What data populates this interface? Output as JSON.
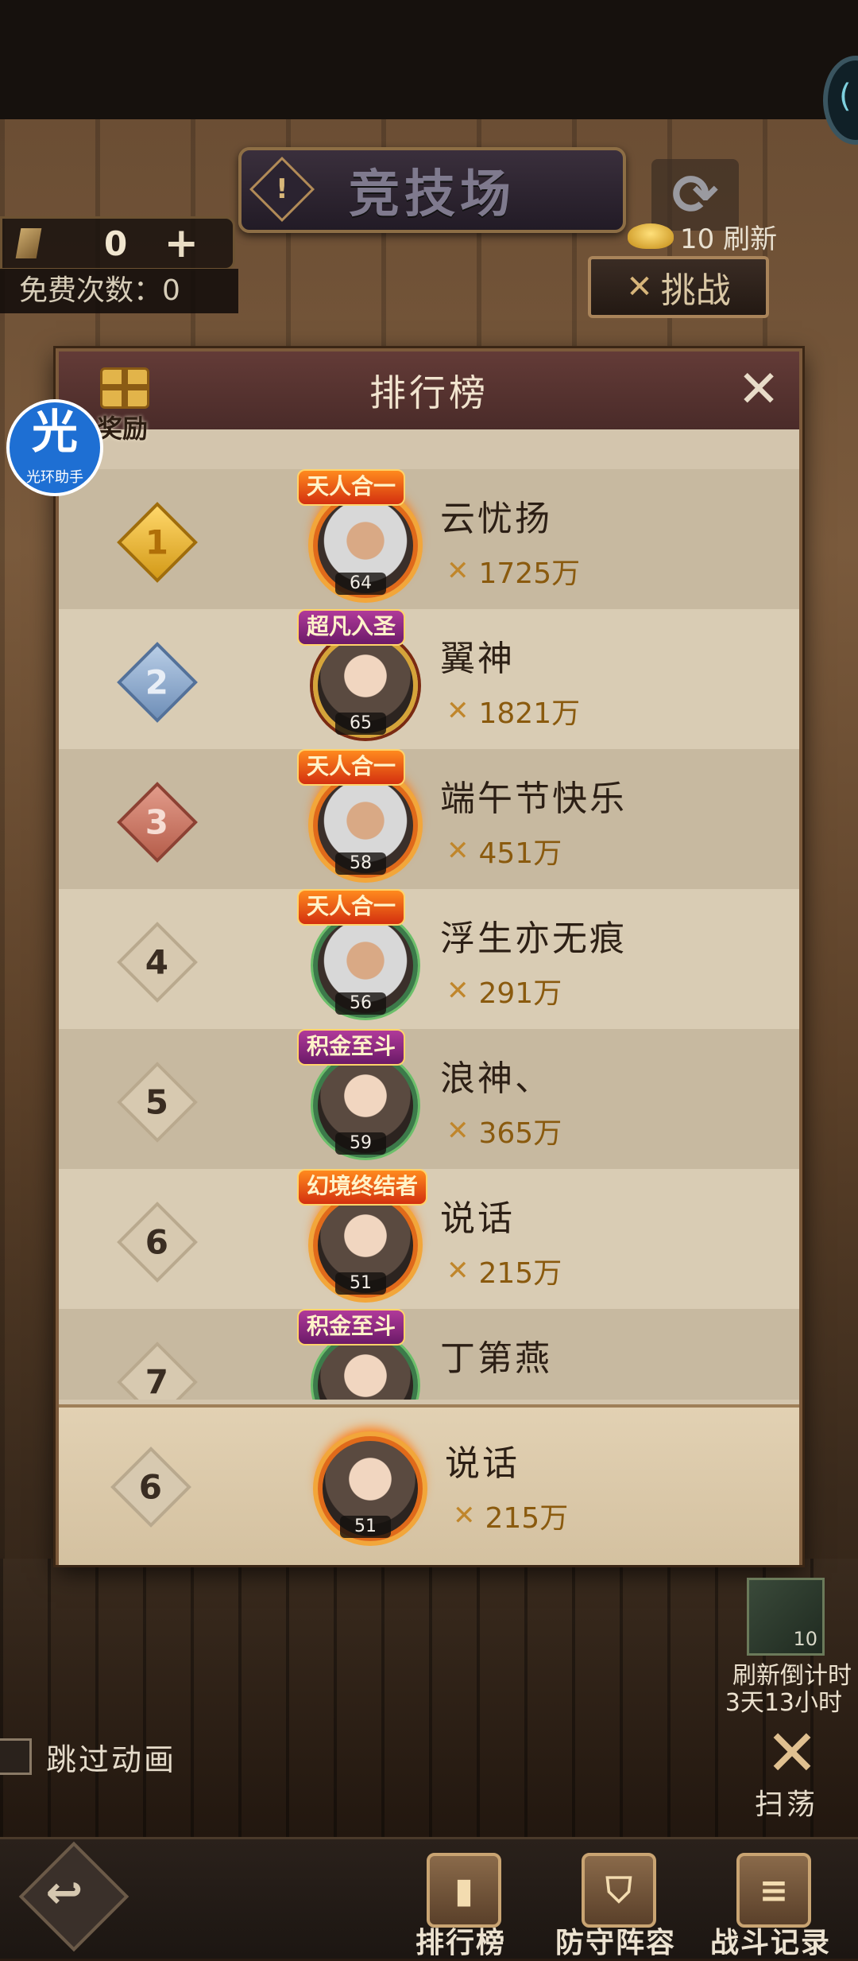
{
  "header": {
    "title": "竞技场",
    "ticket_count": "0",
    "free_count": "免费次数：0",
    "refresh_cost": "10 刷新",
    "challenge_label": "挑战",
    "corner_text": "("
  },
  "modal": {
    "title": "排行榜",
    "reward_label": "奖励",
    "close_symbol": "✕"
  },
  "assistant": {
    "glyph": "光",
    "label": "光环助手"
  },
  "rankings": [
    {
      "rank": "1",
      "title_tag": "天人合一",
      "name": "云忧扬",
      "power": "1725万",
      "level": "64"
    },
    {
      "rank": "2",
      "title_tag": "超凡入圣",
      "name": "翼神",
      "power": "1821万",
      "level": "65"
    },
    {
      "rank": "3",
      "title_tag": "天人合一",
      "name": "端午节快乐",
      "power": "451万",
      "level": "58"
    },
    {
      "rank": "4",
      "title_tag": "天人合一",
      "name": "浮生亦无痕",
      "power": "291万",
      "level": "56"
    },
    {
      "rank": "5",
      "title_tag": "积金至斗",
      "name": "浪神、",
      "power": "365万",
      "level": "59"
    },
    {
      "rank": "6",
      "title_tag": "幻境终结者",
      "name": "说话",
      "power": "215万",
      "level": "51"
    },
    {
      "rank": "7",
      "title_tag": "积金至斗",
      "name": "丁第燕",
      "power": "",
      "level": ""
    }
  ],
  "my_rank": {
    "rank": "6",
    "name": "说话",
    "power": "215万",
    "level": "51"
  },
  "hud": {
    "countdown_badge": "10",
    "countdown_label": "刷新倒计时",
    "countdown_time": "3天13小时",
    "skip_label": "跳过动画",
    "sweep_label": "扫荡"
  },
  "bottom_nav": [
    {
      "label": "排行榜",
      "icon": "leaderboard-icon"
    },
    {
      "label": "防守阵容",
      "icon": "shield-icon"
    },
    {
      "label": "战斗记录",
      "icon": "scroll-icon"
    }
  ]
}
